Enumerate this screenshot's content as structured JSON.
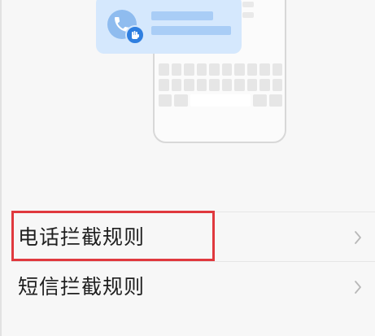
{
  "illustration": {
    "icons": [
      "phone-call-icon",
      "hand-stop-icon"
    ],
    "accent_color": "#2f7fe0",
    "card_color": "#d5e8fd"
  },
  "rules_list": {
    "items": [
      {
        "label": "电话拦截规则",
        "icon": "chevron-right-icon",
        "highlighted": true
      },
      {
        "label": "短信拦截规则",
        "icon": "chevron-right-icon",
        "highlighted": false
      }
    ]
  },
  "highlight_color": "#e0393e"
}
